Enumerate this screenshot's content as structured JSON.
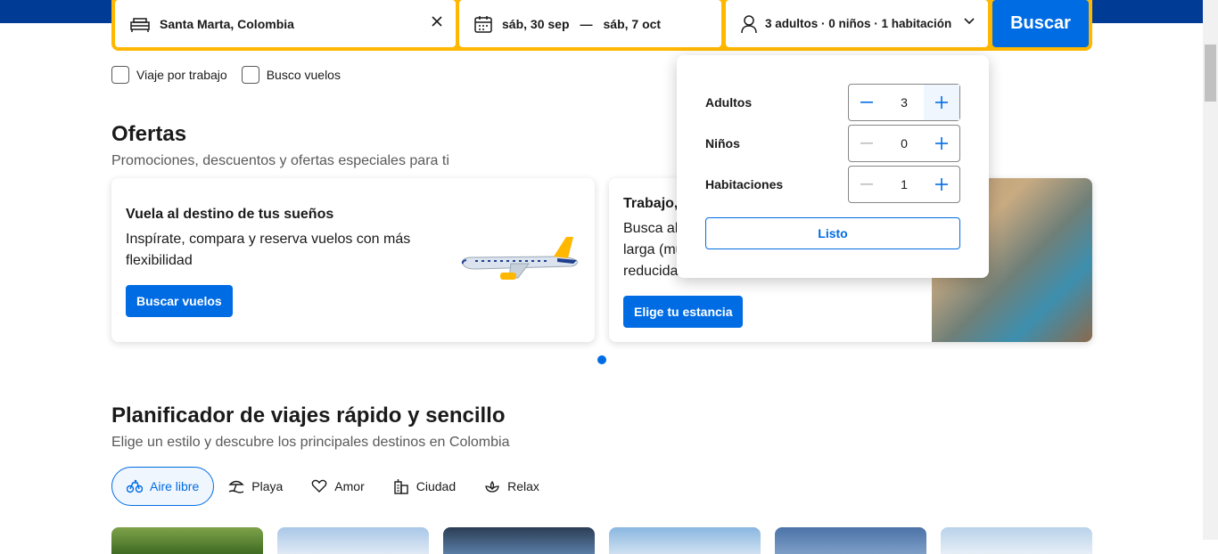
{
  "search": {
    "destination": "Santa Marta, Colombia",
    "check_in": "sáb, 30 sep",
    "separator": "—",
    "check_out": "sáb, 7 oct",
    "occupancy": "3 adultos · 0 niños · 1 habitación",
    "search_button": "Buscar"
  },
  "filters": {
    "work_trip": "Viaje por trabajo",
    "flights": "Busco vuelos"
  },
  "offers": {
    "title": "Ofertas",
    "subtitle": "Promociones, descuentos y ofertas especiales para ti",
    "cards": [
      {
        "title": "Vuela al destino de tus sueños",
        "body_line1": "Inspírate, compara y reserva vuelos con más",
        "body_line2": "flexibilidad",
        "button": "Buscar vuelos"
      },
      {
        "title": "Trabajo,",
        "body_line1": "Busca alo",
        "body_line2": "larga (mu",
        "body_line3": "reducida",
        "button": "Elige tu estancia"
      }
    ]
  },
  "occupancy_popover": {
    "rows": [
      {
        "label": "Adultos",
        "value": "3"
      },
      {
        "label": "Niños",
        "value": "0"
      },
      {
        "label": "Habitaciones",
        "value": "1"
      }
    ],
    "done_button": "Listo"
  },
  "planner": {
    "title": "Planificador de viajes rápido y sencillo",
    "subtitle": "Elige un estilo y descubre los principales destinos en Colombia",
    "tabs": [
      {
        "label": "Aire libre",
        "icon": "bicycle-icon",
        "active": true
      },
      {
        "label": "Playa",
        "icon": "beach-icon",
        "active": false
      },
      {
        "label": "Amor",
        "icon": "heart-icon",
        "active": false
      },
      {
        "label": "Ciudad",
        "icon": "city-icon",
        "active": false
      },
      {
        "label": "Relax",
        "icon": "spa-icon",
        "active": false
      }
    ]
  },
  "colors": {
    "brand_blue": "#003b95",
    "accent": "#006ce4",
    "search_border": "#ffb700"
  }
}
